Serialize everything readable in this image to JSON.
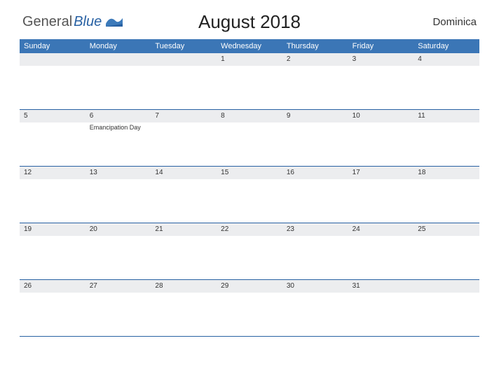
{
  "logo": {
    "text1": "General",
    "text2": "Blue"
  },
  "title": "August 2018",
  "region": "Dominica",
  "weekdays": [
    "Sunday",
    "Monday",
    "Tuesday",
    "Wednesday",
    "Thursday",
    "Friday",
    "Saturday"
  ],
  "weeks": [
    {
      "days": [
        "",
        "",
        "",
        "1",
        "2",
        "3",
        "4"
      ],
      "events": [
        "",
        "",
        "",
        "",
        "",
        "",
        ""
      ]
    },
    {
      "days": [
        "5",
        "6",
        "7",
        "8",
        "9",
        "10",
        "11"
      ],
      "events": [
        "",
        "Emancipation Day",
        "",
        "",
        "",
        "",
        ""
      ]
    },
    {
      "days": [
        "12",
        "13",
        "14",
        "15",
        "16",
        "17",
        "18"
      ],
      "events": [
        "",
        "",
        "",
        "",
        "",
        "",
        ""
      ]
    },
    {
      "days": [
        "19",
        "20",
        "21",
        "22",
        "23",
        "24",
        "25"
      ],
      "events": [
        "",
        "",
        "",
        "",
        "",
        "",
        ""
      ]
    },
    {
      "days": [
        "26",
        "27",
        "28",
        "29",
        "30",
        "31",
        ""
      ],
      "events": [
        "",
        "",
        "",
        "",
        "",
        "",
        ""
      ]
    }
  ]
}
